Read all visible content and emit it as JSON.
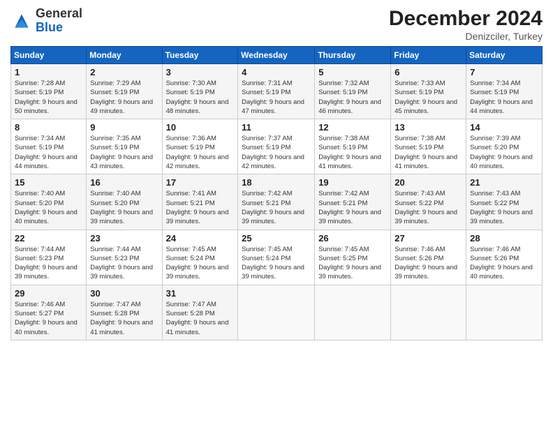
{
  "header": {
    "logo_general": "General",
    "logo_blue": "Blue",
    "month_title": "December 2024",
    "subtitle": "Denizciler, Turkey"
  },
  "weekdays": [
    "Sunday",
    "Monday",
    "Tuesday",
    "Wednesday",
    "Thursday",
    "Friday",
    "Saturday"
  ],
  "weeks": [
    [
      {
        "day": "1",
        "sunrise": "Sunrise: 7:28 AM",
        "sunset": "Sunset: 5:19 PM",
        "daylight": "Daylight: 9 hours and 50 minutes."
      },
      {
        "day": "2",
        "sunrise": "Sunrise: 7:29 AM",
        "sunset": "Sunset: 5:19 PM",
        "daylight": "Daylight: 9 hours and 49 minutes."
      },
      {
        "day": "3",
        "sunrise": "Sunrise: 7:30 AM",
        "sunset": "Sunset: 5:19 PM",
        "daylight": "Daylight: 9 hours and 48 minutes."
      },
      {
        "day": "4",
        "sunrise": "Sunrise: 7:31 AM",
        "sunset": "Sunset: 5:19 PM",
        "daylight": "Daylight: 9 hours and 47 minutes."
      },
      {
        "day": "5",
        "sunrise": "Sunrise: 7:32 AM",
        "sunset": "Sunset: 5:19 PM",
        "daylight": "Daylight: 9 hours and 46 minutes."
      },
      {
        "day": "6",
        "sunrise": "Sunrise: 7:33 AM",
        "sunset": "Sunset: 5:19 PM",
        "daylight": "Daylight: 9 hours and 45 minutes."
      },
      {
        "day": "7",
        "sunrise": "Sunrise: 7:34 AM",
        "sunset": "Sunset: 5:19 PM",
        "daylight": "Daylight: 9 hours and 44 minutes."
      }
    ],
    [
      {
        "day": "8",
        "sunrise": "Sunrise: 7:34 AM",
        "sunset": "Sunset: 5:19 PM",
        "daylight": "Daylight: 9 hours and 44 minutes."
      },
      {
        "day": "9",
        "sunrise": "Sunrise: 7:35 AM",
        "sunset": "Sunset: 5:19 PM",
        "daylight": "Daylight: 9 hours and 43 minutes."
      },
      {
        "day": "10",
        "sunrise": "Sunrise: 7:36 AM",
        "sunset": "Sunset: 5:19 PM",
        "daylight": "Daylight: 9 hours and 42 minutes."
      },
      {
        "day": "11",
        "sunrise": "Sunrise: 7:37 AM",
        "sunset": "Sunset: 5:19 PM",
        "daylight": "Daylight: 9 hours and 42 minutes."
      },
      {
        "day": "12",
        "sunrise": "Sunrise: 7:38 AM",
        "sunset": "Sunset: 5:19 PM",
        "daylight": "Daylight: 9 hours and 41 minutes."
      },
      {
        "day": "13",
        "sunrise": "Sunrise: 7:38 AM",
        "sunset": "Sunset: 5:19 PM",
        "daylight": "Daylight: 9 hours and 41 minutes."
      },
      {
        "day": "14",
        "sunrise": "Sunrise: 7:39 AM",
        "sunset": "Sunset: 5:20 PM",
        "daylight": "Daylight: 9 hours and 40 minutes."
      }
    ],
    [
      {
        "day": "15",
        "sunrise": "Sunrise: 7:40 AM",
        "sunset": "Sunset: 5:20 PM",
        "daylight": "Daylight: 9 hours and 40 minutes."
      },
      {
        "day": "16",
        "sunrise": "Sunrise: 7:40 AM",
        "sunset": "Sunset: 5:20 PM",
        "daylight": "Daylight: 9 hours and 39 minutes."
      },
      {
        "day": "17",
        "sunrise": "Sunrise: 7:41 AM",
        "sunset": "Sunset: 5:21 PM",
        "daylight": "Daylight: 9 hours and 39 minutes."
      },
      {
        "day": "18",
        "sunrise": "Sunrise: 7:42 AM",
        "sunset": "Sunset: 5:21 PM",
        "daylight": "Daylight: 9 hours and 39 minutes."
      },
      {
        "day": "19",
        "sunrise": "Sunrise: 7:42 AM",
        "sunset": "Sunset: 5:21 PM",
        "daylight": "Daylight: 9 hours and 39 minutes."
      },
      {
        "day": "20",
        "sunrise": "Sunrise: 7:43 AM",
        "sunset": "Sunset: 5:22 PM",
        "daylight": "Daylight: 9 hours and 39 minutes."
      },
      {
        "day": "21",
        "sunrise": "Sunrise: 7:43 AM",
        "sunset": "Sunset: 5:22 PM",
        "daylight": "Daylight: 9 hours and 39 minutes."
      }
    ],
    [
      {
        "day": "22",
        "sunrise": "Sunrise: 7:44 AM",
        "sunset": "Sunset: 5:23 PM",
        "daylight": "Daylight: 9 hours and 39 minutes."
      },
      {
        "day": "23",
        "sunrise": "Sunrise: 7:44 AM",
        "sunset": "Sunset: 5:23 PM",
        "daylight": "Daylight: 9 hours and 39 minutes."
      },
      {
        "day": "24",
        "sunrise": "Sunrise: 7:45 AM",
        "sunset": "Sunset: 5:24 PM",
        "daylight": "Daylight: 9 hours and 39 minutes."
      },
      {
        "day": "25",
        "sunrise": "Sunrise: 7:45 AM",
        "sunset": "Sunset: 5:24 PM",
        "daylight": "Daylight: 9 hours and 39 minutes."
      },
      {
        "day": "26",
        "sunrise": "Sunrise: 7:45 AM",
        "sunset": "Sunset: 5:25 PM",
        "daylight": "Daylight: 9 hours and 39 minutes."
      },
      {
        "day": "27",
        "sunrise": "Sunrise: 7:46 AM",
        "sunset": "Sunset: 5:26 PM",
        "daylight": "Daylight: 9 hours and 39 minutes."
      },
      {
        "day": "28",
        "sunrise": "Sunrise: 7:46 AM",
        "sunset": "Sunset: 5:26 PM",
        "daylight": "Daylight: 9 hours and 40 minutes."
      }
    ],
    [
      {
        "day": "29",
        "sunrise": "Sunrise: 7:46 AM",
        "sunset": "Sunset: 5:27 PM",
        "daylight": "Daylight: 9 hours and 40 minutes."
      },
      {
        "day": "30",
        "sunrise": "Sunrise: 7:47 AM",
        "sunset": "Sunset: 5:28 PM",
        "daylight": "Daylight: 9 hours and 41 minutes."
      },
      {
        "day": "31",
        "sunrise": "Sunrise: 7:47 AM",
        "sunset": "Sunset: 5:28 PM",
        "daylight": "Daylight: 9 hours and 41 minutes."
      },
      null,
      null,
      null,
      null
    ]
  ]
}
